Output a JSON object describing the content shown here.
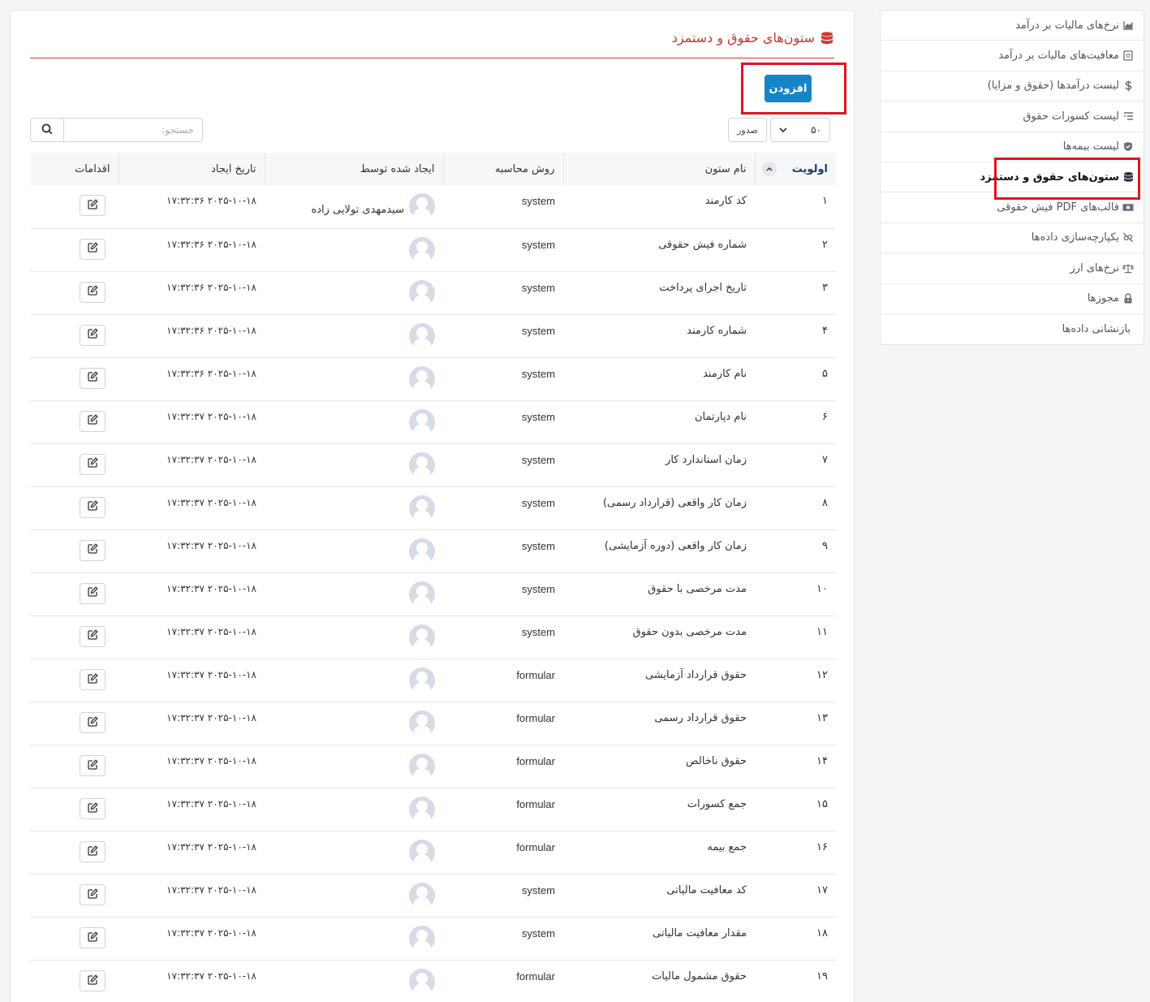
{
  "sidebar": {
    "items": [
      {
        "label": "نرخ‌های مالیات بر درآمد",
        "icon": "chart-area-icon"
      },
      {
        "label": "معافیت‌های مالیات بر درآمد",
        "icon": "receipt-icon"
      },
      {
        "label": "لیست درآمدها (حقوق و مزایا)",
        "icon": "dollar-icon"
      },
      {
        "label": "لیست کسورات حقوق",
        "icon": "list-minus-icon"
      },
      {
        "label": "لیست بیمه‌ها",
        "icon": "shield-icon"
      },
      {
        "label": "ستون‌های حقوق و دستمزد",
        "icon": "database-icon"
      },
      {
        "label": "قالب‌های PDF فیش حقوقی",
        "icon": "money-bill-icon"
      },
      {
        "label": "یکپارچه‌سازی داده‌ها",
        "icon": "link-slash-icon"
      },
      {
        "label": "نرخ‌های ارز",
        "icon": "scale-icon"
      },
      {
        "label": "مجوزها",
        "icon": "lock-icon"
      },
      {
        "label": "بازنشانی داده‌ها",
        "icon": ""
      }
    ]
  },
  "page": {
    "title": "ستون‌های حقوق و دستمزد",
    "add_label": "افزودن",
    "page_size": "۵۰",
    "export_label": "صدور",
    "search_placeholder": "جستجو:"
  },
  "table": {
    "headers": {
      "priority": "اولویت",
      "name": "نام ستون",
      "method": "روش محاسبه",
      "creator": "ایجاد شده توسط",
      "created": "تاریخ ایجاد",
      "actions": "اقدامات"
    },
    "rows": [
      {
        "priority": "۱",
        "name": "کد کارمند",
        "method": "system",
        "creator": "سیدمهدی تولایی زاده",
        "created": "۲۰۲۵-۱۰-۱۸ ۱۷:۳۲:۳۶"
      },
      {
        "priority": "۲",
        "name": "شماره فیش حقوقی",
        "method": "system",
        "creator": "",
        "created": "۲۰۲۵-۱۰-۱۸ ۱۷:۳۲:۳۶"
      },
      {
        "priority": "۳",
        "name": "تاریخ اجرای پرداخت",
        "method": "system",
        "creator": "",
        "created": "۲۰۲۵-۱۰-۱۸ ۱۷:۳۲:۳۶"
      },
      {
        "priority": "۴",
        "name": "شماره کارمند",
        "method": "system",
        "creator": "",
        "created": "۲۰۲۵-۱۰-۱۸ ۱۷:۳۲:۳۶"
      },
      {
        "priority": "۵",
        "name": "نام کارمند",
        "method": "system",
        "creator": "",
        "created": "۲۰۲۵-۱۰-۱۸ ۱۷:۳۲:۳۶"
      },
      {
        "priority": "۶",
        "name": "نام دپارتمان",
        "method": "system",
        "creator": "",
        "created": "۲۰۲۵-۱۰-۱۸ ۱۷:۳۲:۳۷"
      },
      {
        "priority": "۷",
        "name": "زمان استاندارد کار",
        "method": "system",
        "creator": "",
        "created": "۲۰۲۵-۱۰-۱۸ ۱۷:۳۲:۳۷"
      },
      {
        "priority": "۸",
        "name": "زمان کار واقعی (قرارداد رسمی)",
        "method": "system",
        "creator": "",
        "created": "۲۰۲۵-۱۰-۱۸ ۱۷:۳۲:۳۷"
      },
      {
        "priority": "۹",
        "name": "زمان کار واقعی (دوره آزمایشی)",
        "method": "system",
        "creator": "",
        "created": "۲۰۲۵-۱۰-۱۸ ۱۷:۳۲:۳۷"
      },
      {
        "priority": "۱۰",
        "name": "مدت مرخصی با حقوق",
        "method": "system",
        "creator": "",
        "created": "۲۰۲۵-۱۰-۱۸ ۱۷:۳۲:۳۷"
      },
      {
        "priority": "۱۱",
        "name": "مدت مرخصی بدون حقوق",
        "method": "system",
        "creator": "",
        "created": "۲۰۲۵-۱۰-۱۸ ۱۷:۳۲:۳۷"
      },
      {
        "priority": "۱۲",
        "name": "حقوق قرارداد آزمایشی",
        "method": "formular",
        "creator": "",
        "created": "۲۰۲۵-۱۰-۱۸ ۱۷:۳۲:۳۷"
      },
      {
        "priority": "۱۳",
        "name": "حقوق قرارداد رسمی",
        "method": "formular",
        "creator": "",
        "created": "۲۰۲۵-۱۰-۱۸ ۱۷:۳۲:۳۷"
      },
      {
        "priority": "۱۴",
        "name": "حقوق ناخالص",
        "method": "formular",
        "creator": "",
        "created": "۲۰۲۵-۱۰-۱۸ ۱۷:۳۲:۳۷"
      },
      {
        "priority": "۱۵",
        "name": "جمع کسورات",
        "method": "formular",
        "creator": "",
        "created": "۲۰۲۵-۱۰-۱۸ ۱۷:۳۲:۳۷"
      },
      {
        "priority": "۱۶",
        "name": "جمع بیمه",
        "method": "formular",
        "creator": "",
        "created": "۲۰۲۵-۱۰-۱۸ ۱۷:۳۲:۳۷"
      },
      {
        "priority": "۱۷",
        "name": "کد معافیت مالیاتی",
        "method": "system",
        "creator": "",
        "created": "۲۰۲۵-۱۰-۱۸ ۱۷:۳۲:۳۷"
      },
      {
        "priority": "۱۸",
        "name": "مقدار معافیت مالیاتی",
        "method": "system",
        "creator": "",
        "created": "۲۰۲۵-۱۰-۱۸ ۱۷:۳۲:۳۷"
      },
      {
        "priority": "۱۹",
        "name": "حقوق مشمول مالیات",
        "method": "formular",
        "creator": "",
        "created": "۲۰۲۵-۱۰-۱۸ ۱۷:۳۲:۳۷"
      }
    ]
  },
  "colors": {
    "title": "#c0392b",
    "primary_button": "#1585c8",
    "highlight": "#e0141e",
    "header_priority": "#1f3b70"
  }
}
